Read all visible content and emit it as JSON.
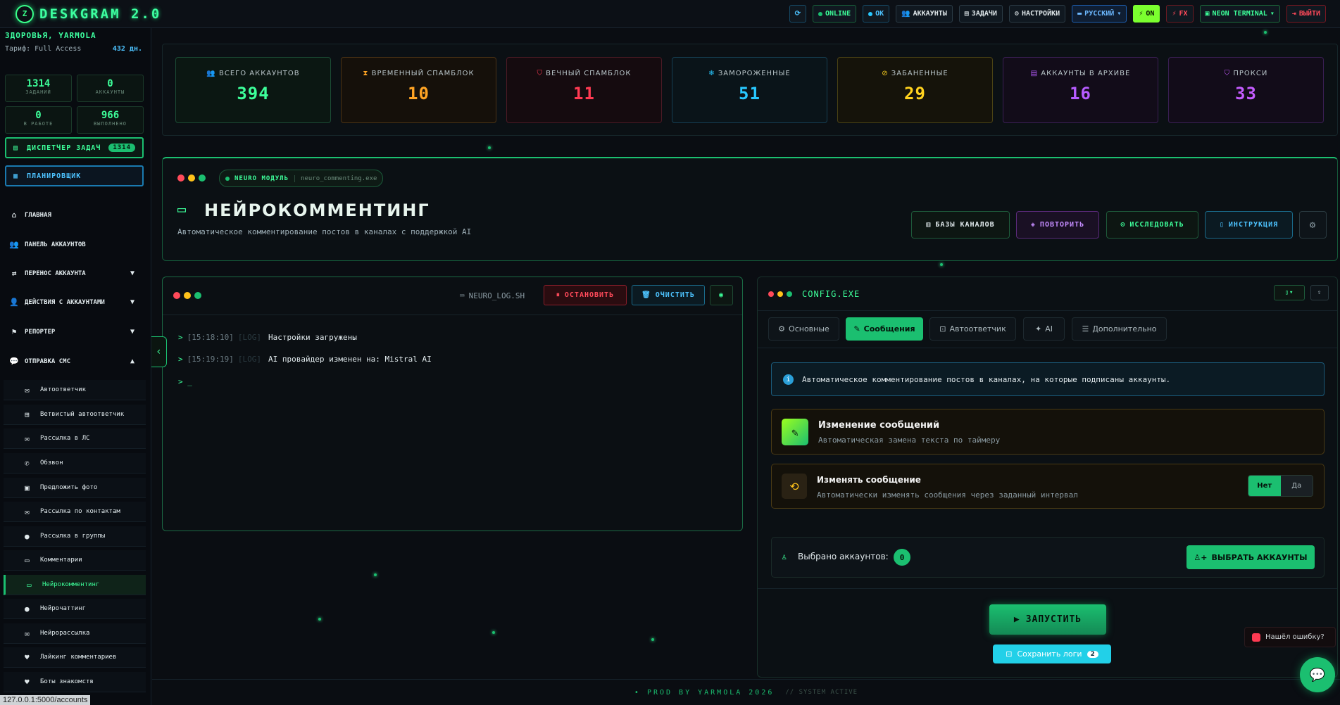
{
  "app": {
    "logo_letter": "Z",
    "name": "DESKGRAM 2.0"
  },
  "topbar": {
    "refresh_icon": "refresh-icon",
    "online": "ONLINE",
    "ok": "OK",
    "accounts": "АККАУНТЫ",
    "tasks": "ЗАДАЧИ",
    "settings": "НАСТРОЙКИ",
    "language": "РУССКИЙ",
    "on": "ON",
    "fx": "FX",
    "neon": "NEON TERMINAL",
    "exit": "ВЫЙТИ"
  },
  "sidebar": {
    "greeting": "ЗДОРОВЬЯ, YARMOLA",
    "tariff": "Тариф: Full Access",
    "days": "432 дн.",
    "stats": [
      {
        "value": "1314",
        "label": "ЗАДАНИЙ"
      },
      {
        "value": "0",
        "label": "АККАУНТЫ"
      },
      {
        "value": "0",
        "label": "В РАБОТЕ"
      },
      {
        "value": "966",
        "label": "ВЫПОЛНЕНО"
      }
    ],
    "dispatcher": "ДИСПЕТЧЕР ЗАДАЧ",
    "dispatcher_count": "1314",
    "scheduler": "ПЛАНИРОВЩИК",
    "nav": [
      {
        "label": "ГЛАВНАЯ"
      },
      {
        "label": "ПАНЕЛЬ АККАУНТОВ"
      },
      {
        "label": "ПЕРЕНОС АККАУНТА"
      },
      {
        "label": "ДЕЙСТВИЯ С АККАУНТАМИ"
      },
      {
        "label": "РЕПОРТЕР"
      },
      {
        "label": "ОТПРАВКА СМС"
      }
    ],
    "sub": [
      {
        "label": "Автоответчик"
      },
      {
        "label": "Ветвистый автоответчик"
      },
      {
        "label": "Рассылка в ЛС"
      },
      {
        "label": "Обзвон"
      },
      {
        "label": "Предложить фото"
      },
      {
        "label": "Рассылка по контактам"
      },
      {
        "label": "Рассылка в группы"
      },
      {
        "label": "Комментарии"
      },
      {
        "label": "Нейрокомментинг"
      },
      {
        "label": "Нейрочаттинг"
      },
      {
        "label": "Нейрорассылка"
      },
      {
        "label": "Лайкинг комментариев"
      },
      {
        "label": "Боты знакомств"
      }
    ],
    "status_url": "127.0.0.1:5000/accounts"
  },
  "stats": [
    {
      "title": "ВСЕГО АККАУНТОВ",
      "value": "394",
      "color": "#3dff9a"
    },
    {
      "title": "ВРЕМЕННЫЙ СПАМБЛОК",
      "value": "10",
      "color": "#ffa424"
    },
    {
      "title": "ВЕЧНЫЙ СПАМБЛОК",
      "value": "11",
      "color": "#ff3a52"
    },
    {
      "title": "ЗАМОРОЖЕННЫЕ",
      "value": "51",
      "color": "#28c8ff"
    },
    {
      "title": "ЗАБАНЕННЫЕ",
      "value": "29",
      "color": "#ffd21e"
    },
    {
      "title": "АККАУНТЫ В АРХИВЕ",
      "value": "16",
      "color": "#b65cff"
    },
    {
      "title": "ПРОКСИ",
      "value": "33",
      "color": "#c55cff"
    }
  ],
  "neuro": {
    "tag": "NEURO МОДУЛЬ",
    "file": "neuro_commenting.exe",
    "title": "НЕЙРОКОММЕНТИНГ",
    "desc": "Автоматическое комментирование постов в каналах с поддержкой AI",
    "btn_bases": "БАЗЫ КАНАЛОВ",
    "btn_repeat": "ПОВТОРИТЬ",
    "btn_research": "ИССЛЕДОВАТЬ",
    "btn_instr": "ИНСТРУКЦИЯ"
  },
  "log": {
    "file": "NEURO_LOG.SH",
    "stop": "ОСТАНОВИТЬ",
    "clear": "ОЧИСТИТЬ",
    "lines": [
      {
        "time": "[15:18:10]",
        "tag": "[LOG]",
        "msg": "Настройки загружены"
      },
      {
        "time": "[15:19:19]",
        "tag": "[LOG]",
        "msg": "AI провайдер изменен на: Mistral AI"
      }
    ],
    "prompt": "> _"
  },
  "config": {
    "title": "CONFIG.EXE",
    "tabs": [
      "Основные",
      "Сообщения",
      "Автоответчик",
      "AI",
      "Дополнительно"
    ],
    "info": "Автоматическое комментирование постов в каналах, на которые подписаны аккаунты.",
    "f1_title": "Изменение сообщений",
    "f1_sub": "Автоматическая замена текста по таймеру",
    "f2_title": "Изменять сообщение",
    "f2_sub": "Автоматически изменять сообщения через заданный интервал",
    "toggle_no": "Нет",
    "toggle_yes": "Да",
    "selected_label": "Выбрано аккаунтов:",
    "selected_count": "0",
    "select_btn": "ВЫБРАТЬ АККАУНТЫ",
    "run": "ЗАПУСТИТЬ",
    "save_logs": "Сохранить логи",
    "save_count": "2"
  },
  "footer": {
    "prod": "PROD BY YARMOLA 2026",
    "system": "// SYSTEM ACTIVE"
  },
  "bug": "Нашёл ошибку?"
}
